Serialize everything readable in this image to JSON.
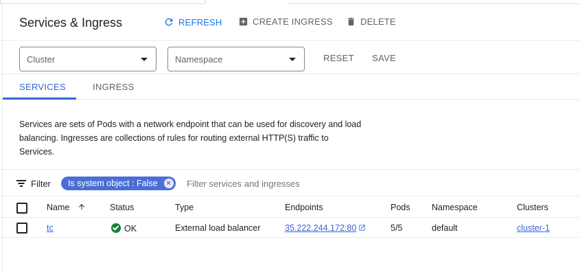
{
  "header": {
    "title": "Services & Ingress",
    "refresh_label": "REFRESH",
    "create_label": "CREATE INGRESS",
    "delete_label": "DELETE"
  },
  "filters": {
    "cluster_placeholder": "Cluster",
    "namespace_placeholder": "Namespace",
    "reset_label": "RESET",
    "save_label": "SAVE"
  },
  "tabs": [
    {
      "label": "SERVICES",
      "active": true
    },
    {
      "label": "INGRESS",
      "active": false
    }
  ],
  "description": "Services are sets of Pods with a network endpoint that can be used for discovery and load balancing. Ingresses are collections of rules for routing external HTTP(S) traffic to Services.",
  "filterbar": {
    "label": "Filter",
    "chip_text": "Is system object : False",
    "input_placeholder": "Filter services and ingresses"
  },
  "table": {
    "columns": [
      "Name",
      "Status",
      "Type",
      "Endpoints",
      "Pods",
      "Namespace",
      "Clusters"
    ],
    "rows": [
      {
        "name": "tc",
        "status": "OK",
        "type": "External load balancer",
        "endpoint": "35.222.244.172:80",
        "pods": "5/5",
        "namespace": "default",
        "cluster": "cluster-1"
      }
    ]
  },
  "colors": {
    "accent": "#1a73e8",
    "tab_active": "#3367d6",
    "chip": "#4a6fd4",
    "status_ok": "#188038"
  }
}
